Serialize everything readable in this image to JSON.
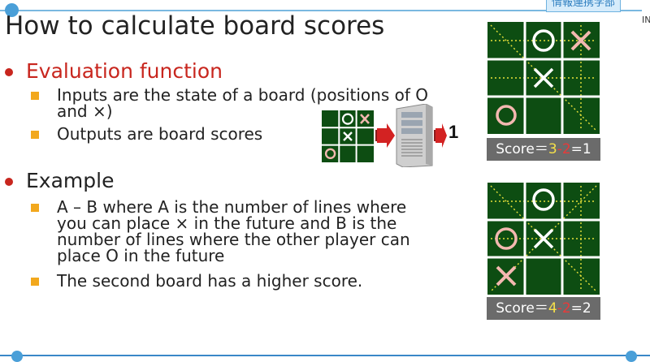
{
  "header": {
    "corner_tag": "情報連携学部",
    "corner_mark": "IN"
  },
  "title": "How to calculate board scores",
  "section1": {
    "heading": "Evaluation function",
    "bullets": [
      {
        "line1": "Inputs are the state of a board (positions of O",
        "line2": "and ×)"
      },
      {
        "line1": "Outputs are board scores"
      }
    ]
  },
  "diagram": {
    "output_label": "1"
  },
  "section2": {
    "heading": "Example",
    "bullets": [
      {
        "lines": [
          "A – B where A is the number of lines where",
          "you can place × in the future and B is the",
          "number of lines where the other player can",
          "place O in the future"
        ]
      },
      {
        "lines": [
          "The second board has a higher score."
        ]
      }
    ]
  },
  "boards": [
    {
      "cells": [
        "",
        "O",
        "X",
        "",
        "X",
        "",
        "O",
        "",
        ""
      ],
      "score": {
        "prefix": "Score＝",
        "a": "3",
        "dash": "-",
        "b": "2",
        "result": "=1"
      }
    },
    {
      "cells": [
        "",
        "O",
        "",
        "O",
        "X",
        "",
        "X",
        "",
        ""
      ],
      "score": {
        "prefix": "Score＝",
        "a": "4",
        "dash": "-",
        "b": "2",
        "result": "=2"
      }
    }
  ],
  "colors": {
    "board_green": "#0d4d12",
    "line_yellow": "#e8e23a",
    "piece_pink": "#f3b8b0",
    "heading_red": "#c8261e",
    "bullet_orange": "#f2a81d"
  }
}
